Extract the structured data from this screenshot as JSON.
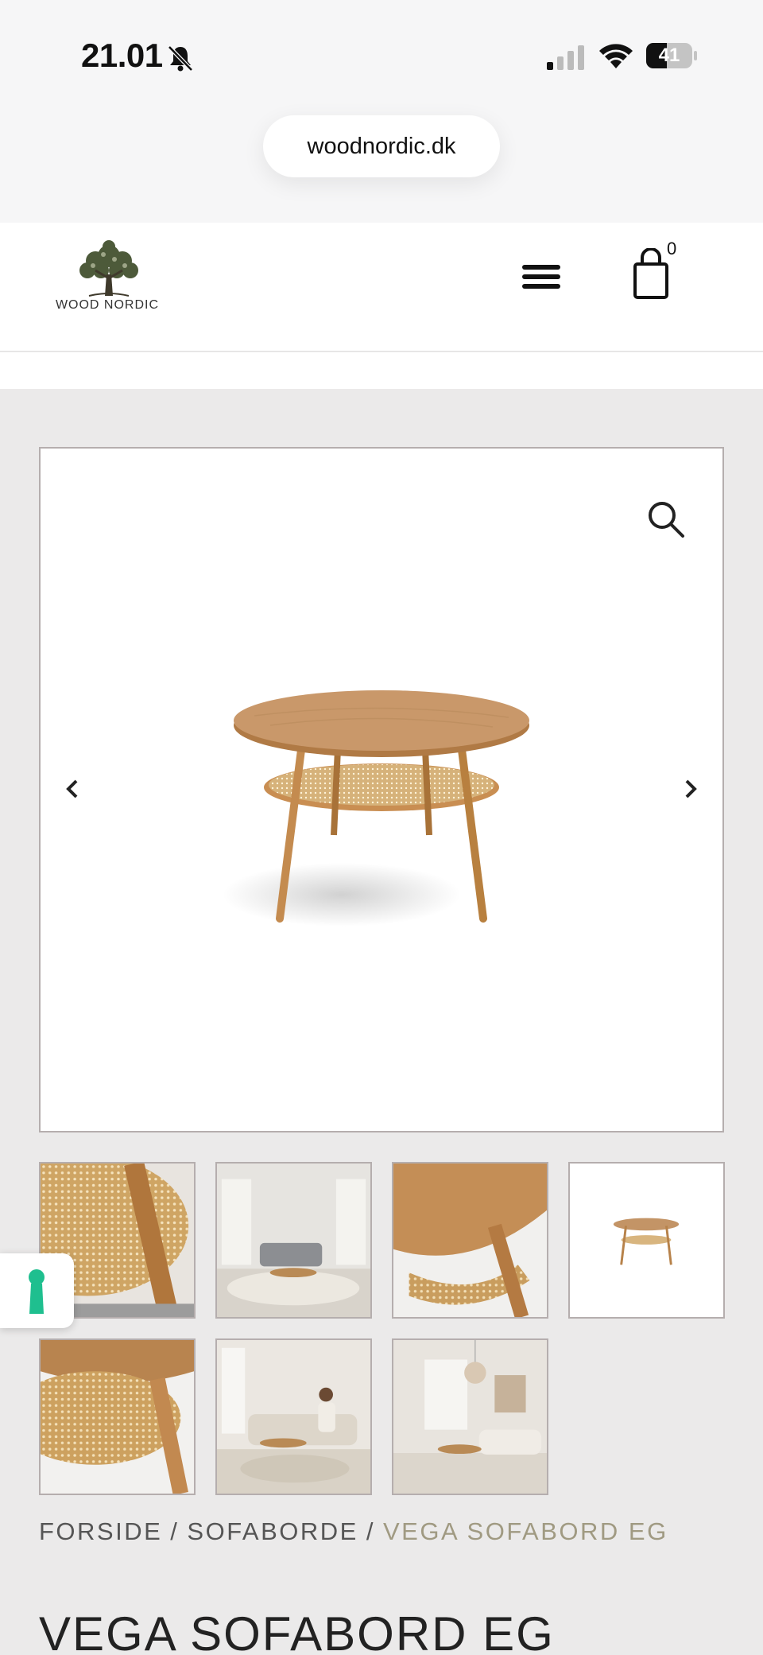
{
  "status_bar": {
    "time": "21.01",
    "battery_level": "41"
  },
  "browser": {
    "url": "woodnordic.dk"
  },
  "header": {
    "logo_text": "WOOD NORDIC",
    "cart_count": "0",
    "menu_icon": "hamburger-menu-icon",
    "cart_icon": "shopping-bag-icon"
  },
  "gallery": {
    "zoom_icon": "search-icon",
    "thumbnails": [
      "rattan-closeup",
      "living-room-sofa",
      "tabletop-closeup",
      "table-white-background",
      "shelf-closeup",
      "woman-sitting-living-room",
      "living-room-pendant-lamp"
    ]
  },
  "breadcrumb": {
    "home": "FORSIDE",
    "category": "SOFABORDE",
    "current": "VEGA SOFABORD EG",
    "separator": "/"
  },
  "product": {
    "title": "VEGA SOFABORD EG"
  },
  "colors": {
    "page_bg": "#ebeaea",
    "accent_breadcrumb": "#a09a82",
    "thumb_border": "#b5aeae",
    "a11y_green": "#1fbf8f"
  }
}
